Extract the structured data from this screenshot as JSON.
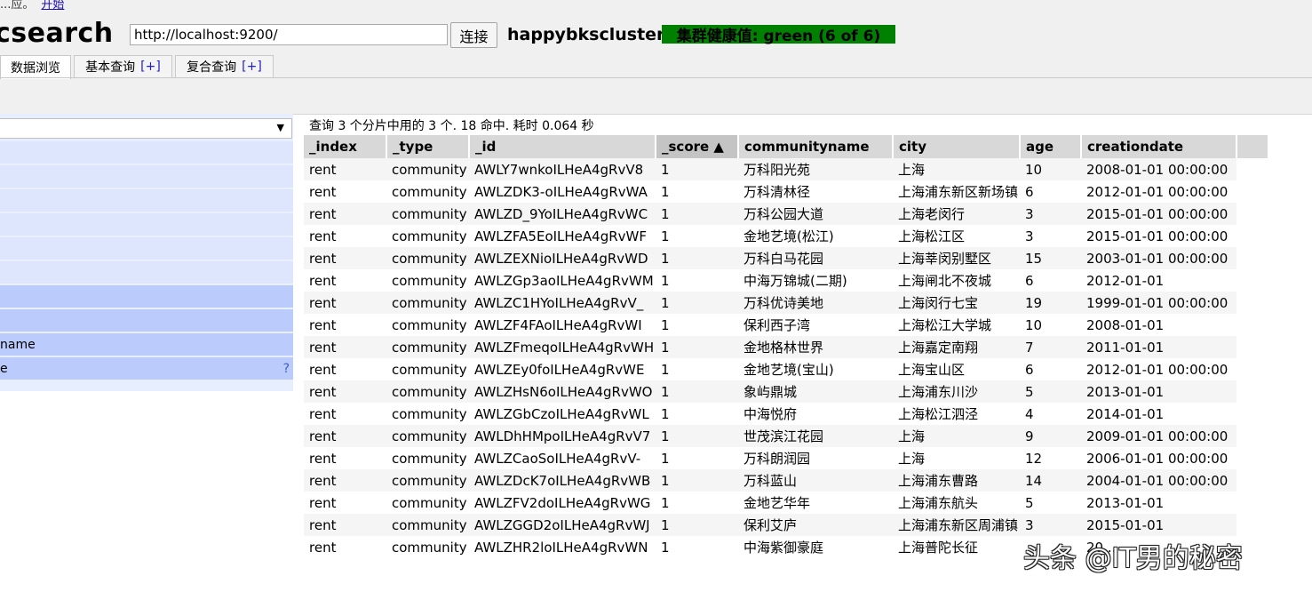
{
  "top_notice": {
    "text": "...应。",
    "link": "开始"
  },
  "header": {
    "logo": "csearch",
    "url_value": "http://localhost:9200/",
    "connect_label": "连接",
    "cluster_name": "happybkscluster",
    "health_text": "集群健康值: green (6 of 6)",
    "health_color": "#008000"
  },
  "tabs": [
    {
      "label": "数据浏览",
      "plus": ""
    },
    {
      "label": "基本查询",
      "plus": "[+]"
    },
    {
      "label": "复合查询",
      "plus": "[+]"
    }
  ],
  "sidebar": {
    "select_arrow": "▼",
    "fields": [
      {
        "label": ""
      },
      {
        "label": ""
      },
      {
        "label": ""
      },
      {
        "label": ""
      },
      {
        "label": ""
      },
      {
        "label": ""
      },
      {
        "label": ""
      },
      {
        "label": ""
      },
      {
        "label": "name"
      },
      {
        "label": "e",
        "help": "?"
      }
    ]
  },
  "results": {
    "summary": "查询 3 个分片中用的 3 个. 18 命中. 耗时 0.064 秒",
    "columns": [
      "_index",
      "_type",
      "_id",
      "_score ▲",
      "communityname",
      "city",
      "age",
      "creationdate"
    ],
    "rows": [
      [
        "rent",
        "community",
        "AWLY7wnkoILHeA4gRvV8",
        "1",
        "万科阳光苑",
        "上海",
        "10",
        "2008-01-01 00:00:00"
      ],
      [
        "rent",
        "community",
        "AWLZDK3-oILHeA4gRvWA",
        "1",
        "万科清林径",
        "上海浦东新区新场镇",
        "6",
        "2012-01-01 00:00:00"
      ],
      [
        "rent",
        "community",
        "AWLZD_9YoILHeA4gRvWC",
        "1",
        "万科公园大道",
        "上海老闵行",
        "3",
        "2015-01-01 00:00:00"
      ],
      [
        "rent",
        "community",
        "AWLZFA5EoILHeA4gRvWF",
        "1",
        "金地艺境(松江)",
        "上海松江区",
        "3",
        "2015-01-01 00:00:00"
      ],
      [
        "rent",
        "community",
        "AWLZEXNioILHeA4gRvWD",
        "1",
        "万科白马花园",
        "上海莘闵别墅区",
        "15",
        "2003-01-01 00:00:00"
      ],
      [
        "rent",
        "community",
        "AWLZGp3aoILHeA4gRvWM",
        "1",
        "中海万锦城(二期)",
        "上海闸北不夜城",
        "6",
        "2012-01-01"
      ],
      [
        "rent",
        "community",
        "AWLZC1HYoILHeA4gRvV_",
        "1",
        "万科优诗美地",
        "上海闵行七宝",
        "19",
        "1999-01-01 00:00:00"
      ],
      [
        "rent",
        "community",
        "AWLZF4FAoILHeA4gRvWI",
        "1",
        "保利西子湾",
        "上海松江大学城",
        "10",
        "2008-01-01"
      ],
      [
        "rent",
        "community",
        "AWLZFmeqoILHeA4gRvWH",
        "1",
        "金地格林世界",
        "上海嘉定南翔",
        "7",
        "2011-01-01"
      ],
      [
        "rent",
        "community",
        "AWLZEy0foILHeA4gRvWE",
        "1",
        "金地艺境(宝山)",
        "上海宝山区",
        "6",
        "2012-01-01 00:00:00"
      ],
      [
        "rent",
        "community",
        "AWLZHsN6oILHeA4gRvWO",
        "1",
        "象屿鼎城",
        "上海浦东川沙",
        "5",
        "2013-01-01"
      ],
      [
        "rent",
        "community",
        "AWLZGbCzoILHeA4gRvWL",
        "1",
        "中海悦府",
        "上海松江泗泾",
        "4",
        "2014-01-01"
      ],
      [
        "rent",
        "community",
        "AWLDhHMpoILHeA4gRvV7",
        "1",
        "世茂滨江花园",
        "上海",
        "9",
        "2009-01-01 00:00:00"
      ],
      [
        "rent",
        "community",
        "AWLZCaoSoILHeA4gRvV-",
        "1",
        "万科朗润园",
        "上海",
        "12",
        "2006-01-01 00:00:00"
      ],
      [
        "rent",
        "community",
        "AWLZDcK7oILHeA4gRvWB",
        "1",
        "万科蓝山",
        "上海浦东曹路",
        "14",
        "2004-01-01 00:00:00"
      ],
      [
        "rent",
        "community",
        "AWLZFV2doILHeA4gRvWG",
        "1",
        "金地艺华年",
        "上海浦东航头",
        "5",
        "2013-01-01"
      ],
      [
        "rent",
        "community",
        "AWLZGGD2oILHeA4gRvWJ",
        "1",
        "保利艾庐",
        "上海浦东新区周浦镇",
        "3",
        "2015-01-01"
      ],
      [
        "rent",
        "community",
        "AWLZHR2loILHeA4gRvWN",
        "1",
        "中海紫御豪庭",
        "上海普陀长征",
        "",
        "20..."
      ]
    ]
  },
  "watermark": "头条 @IT男的秘密"
}
